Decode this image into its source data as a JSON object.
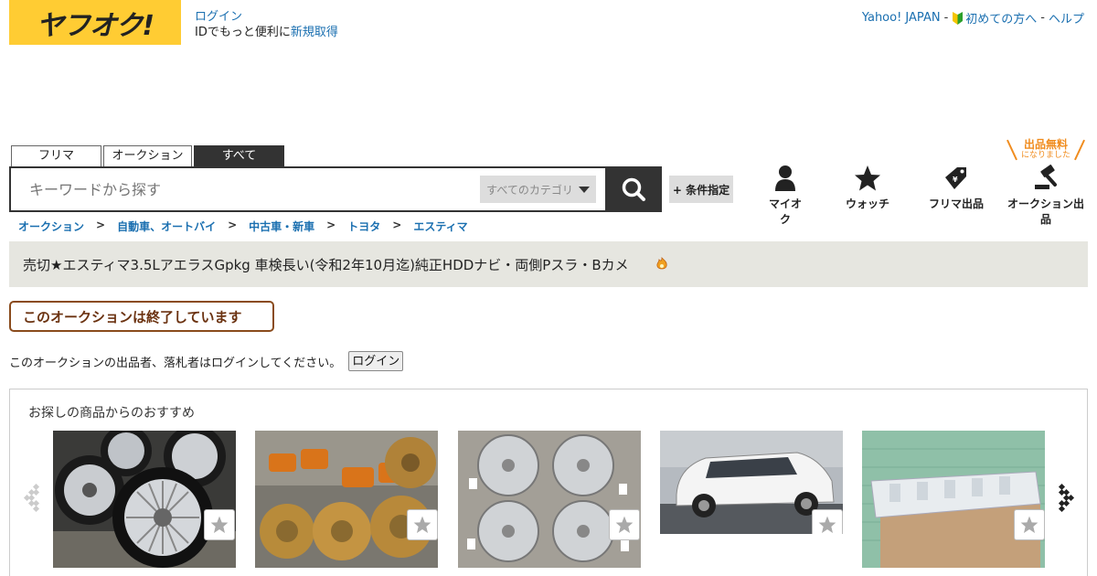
{
  "logo": {
    "text": "ヤフオク!",
    "color": "#ffcc33"
  },
  "header": {
    "login_link": "ログイン",
    "login_prefix": "IDでもっと便利に",
    "register_link": "新規取得",
    "top_links": {
      "yahoo": "Yahoo! JAPAN",
      "first_time": "初めての方へ",
      "help": "ヘルプ",
      "separator": "-"
    }
  },
  "tabs": [
    {
      "label": "フリマ"
    },
    {
      "label": "オークション"
    },
    {
      "label": "すべて",
      "active": true
    }
  ],
  "search": {
    "placeholder": "キーワードから探す",
    "category_selected": "すべてのカテゴリ",
    "button_icon": "search-icon",
    "condition_button": "+ 条件指定"
  },
  "nav": {
    "myauc": {
      "label": "マイオク",
      "icon": "person-icon"
    },
    "watch": {
      "label": "ウォッチ",
      "icon": "star-icon"
    },
    "fleamarket_sell": {
      "label": "フリマ出品",
      "icon": "price-tag-icon"
    },
    "auction_sell": {
      "label": "オークション出品",
      "icon": "gavel-icon"
    },
    "free_badge": {
      "line1": "出品無料",
      "line2": "になりました"
    }
  },
  "breadcrumb": [
    "オークション",
    "自動車、オートバイ",
    "中古車・新車",
    "トヨタ",
    "エスティマ"
  ],
  "item": {
    "title": "売切★エスティマ3.5LアエラスGpkg 車検長い(令和2年10月迄)純正HDDナビ・両側Pスラ・Bカメ"
  },
  "status": {
    "ended_text": "このオークションは終了しています",
    "login_note": "このオークションの出品者、落札者はログインしてください。",
    "login_button": "ログイン"
  },
  "recommendations": {
    "title": "お探しの商品からのおすすめ",
    "items": [
      {
        "image": "silver multi-spoke wheels with tires"
      },
      {
        "image": "gold brake calipers and drilled rotors"
      },
      {
        "image": "four silver 10-spoke wheels"
      },
      {
        "image": "white minivan parked"
      },
      {
        "image": "clear tail lamp on mat"
      }
    ]
  },
  "colors": {
    "accent_link": "#1a6fb0",
    "ended_border": "#8a4b1c",
    "free_orange": "#f08c1e"
  }
}
